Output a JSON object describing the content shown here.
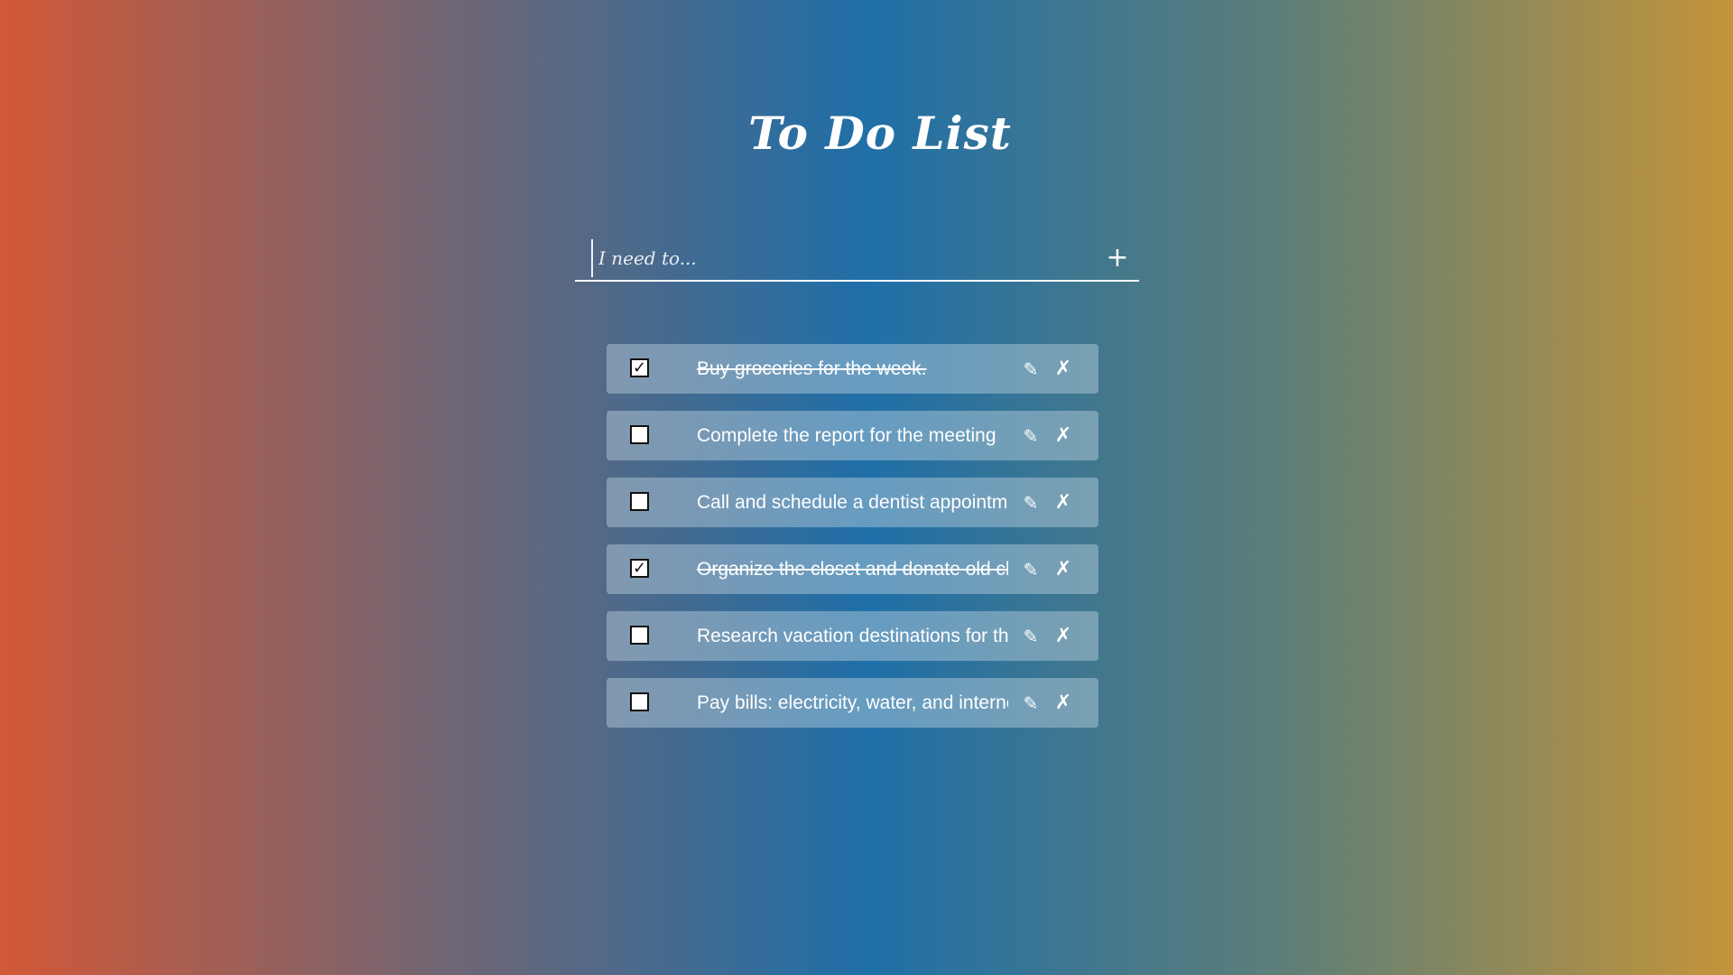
{
  "app": {
    "title": "To Do List"
  },
  "add_form": {
    "placeholder": "I need to...",
    "value": "",
    "add_icon": "+"
  },
  "icons": {
    "check": "✓",
    "edit": "✎",
    "delete": "✗"
  },
  "colors": {
    "gradient": [
      "#d35837",
      "#726572",
      "#1f6fa8",
      "#607f76",
      "#c4943a"
    ],
    "text": "#ffffff"
  },
  "todos": [
    {
      "text": "Buy groceries for the week.",
      "done": true
    },
    {
      "text": "Complete the report for the meeting",
      "done": false
    },
    {
      "text": "Call and schedule a dentist appointment",
      "done": false
    },
    {
      "text": "Organize the closet and donate old clothes",
      "done": true
    },
    {
      "text": "Research vacation destinations for the summer",
      "done": false
    },
    {
      "text": "Pay bills: electricity, water, and internet",
      "done": false
    }
  ]
}
